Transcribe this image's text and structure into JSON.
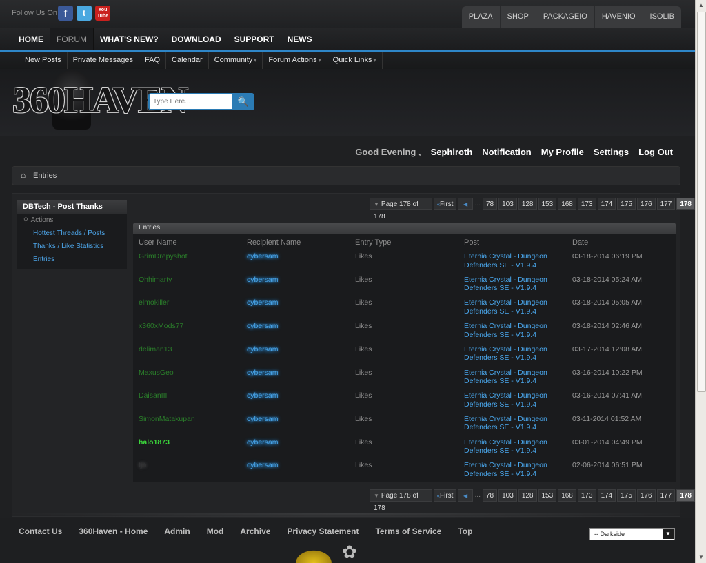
{
  "social": {
    "follow_label": "Follow Us On",
    "facebook_glyph": "f",
    "twitter_glyph": "t",
    "youtube_glyph": "You Tube"
  },
  "toplinks": [
    "PLAZA",
    "SHOP",
    "PACKAGEIO",
    "HAVENIO",
    "ISOLIB"
  ],
  "mainnav": [
    "HOME",
    "FORUM",
    "WHAT'S NEW?",
    "DOWNLOAD",
    "SUPPORT",
    "NEWS"
  ],
  "subnav": [
    {
      "label": "New Posts",
      "caret": ""
    },
    {
      "label": "Private Messages",
      "caret": ""
    },
    {
      "label": "FAQ",
      "caret": ""
    },
    {
      "label": "Calendar",
      "caret": ""
    },
    {
      "label": "Community",
      "caret": "▾"
    },
    {
      "label": "Forum Actions",
      "caret": "▾"
    },
    {
      "label": "Quick Links",
      "caret": "▾"
    }
  ],
  "logo_text": "360HAVEN",
  "search": {
    "placeholder": "Type Here...",
    "button_glyph": "🔍"
  },
  "userbar": {
    "greeting": "Good Evening ,",
    "username": "Sephiroth",
    "notification": "Notification",
    "profile": "My Profile",
    "settings": "Settings",
    "logout": "Log Out"
  },
  "breadcrumb": {
    "home_glyph": "⌂",
    "current": "Entries"
  },
  "sidebar": {
    "title": "DBTech - Post Thanks",
    "actions_label": "Actions",
    "links": [
      "Hottest Threads / Posts",
      "Thanks / Like Statistics",
      "Entries"
    ]
  },
  "pager": {
    "label": "Page 178 of 178",
    "first": "First",
    "dots": "...",
    "pages": [
      "78",
      "103",
      "128",
      "153",
      "168",
      "173",
      "174",
      "175",
      "176",
      "177"
    ],
    "current": "178"
  },
  "entries": {
    "title": "Entries",
    "columns": [
      "User Name",
      "Recipient Name",
      "Entry Type",
      "Post",
      "Date"
    ],
    "rows": [
      {
        "user": "GrimDrepyshot",
        "user_style": "green",
        "recipient": "cybersam",
        "type": "Likes",
        "post_line1": "Eternia Crystal - Dungeon",
        "post_line2": "Defenders SE - V1.9.4",
        "date": "03-18-2014 06:19 PM"
      },
      {
        "user": "Ohhimarty",
        "user_style": "green",
        "recipient": "cybersam",
        "type": "Likes",
        "post_line1": "Eternia Crystal - Dungeon",
        "post_line2": "Defenders SE - V1.9.4",
        "date": "03-18-2014 05:24 AM"
      },
      {
        "user": "elmokiller",
        "user_style": "green",
        "recipient": "cybersam",
        "type": "Likes",
        "post_line1": "Eternia Crystal - Dungeon",
        "post_line2": "Defenders SE - V1.9.4",
        "date": "03-18-2014 05:05 AM"
      },
      {
        "user": "x360xMods77",
        "user_style": "green",
        "recipient": "cybersam",
        "type": "Likes",
        "post_line1": "Eternia Crystal - Dungeon",
        "post_line2": "Defenders SE - V1.9.4",
        "date": "03-18-2014 02:46 AM"
      },
      {
        "user": "deliman13",
        "user_style": "green",
        "recipient": "cybersam",
        "type": "Likes",
        "post_line1": "Eternia Crystal - Dungeon",
        "post_line2": "Defenders SE - V1.9.4",
        "date": "03-17-2014 12:08 AM"
      },
      {
        "user": "MaxusGeo",
        "user_style": "green",
        "recipient": "cybersam",
        "type": "Likes",
        "post_line1": "Eternia Crystal - Dungeon",
        "post_line2": "Defenders SE - V1.9.4",
        "date": "03-16-2014 10:22 PM"
      },
      {
        "user": "DaisanIII",
        "user_style": "green",
        "recipient": "cybersam",
        "type": "Likes",
        "post_line1": "Eternia Crystal - Dungeon",
        "post_line2": "Defenders SE - V1.9.4",
        "date": "03-16-2014 07:41 AM"
      },
      {
        "user": "SimonMatakupan",
        "user_style": "green",
        "recipient": "cybersam",
        "type": "Likes",
        "post_line1": "Eternia Crystal - Dungeon",
        "post_line2": "Defenders SE - V1.9.4",
        "date": "03-11-2014 01:52 AM"
      },
      {
        "user": "halo1873",
        "user_style": "bright",
        "recipient": "cybersam",
        "type": "Likes",
        "post_line1": "Eternia Crystal - Dungeon",
        "post_line2": "Defenders SE - V1.9.4",
        "date": "03-01-2014 04:49 PM"
      },
      {
        "user": "tjb",
        "user_style": "dark",
        "recipient": "cybersam",
        "type": "Likes",
        "post_line1": "Eternia Crystal - Dungeon",
        "post_line2": "Defenders SE - V1.9.4",
        "date": "02-06-2014 06:51 PM"
      }
    ]
  },
  "footer": {
    "links": [
      "Contact Us",
      "360Haven - Home",
      "Admin",
      "Mod",
      "Archive",
      "Privacy Statement",
      "Terms of Service",
      "Top"
    ],
    "style_select": "-- Darkside"
  },
  "colors": {
    "accent_blue": "#2e86c8",
    "link_blue": "#4aa8ee",
    "user_green": "#2a7d2a",
    "user_bright_green": "#3bd43b"
  }
}
